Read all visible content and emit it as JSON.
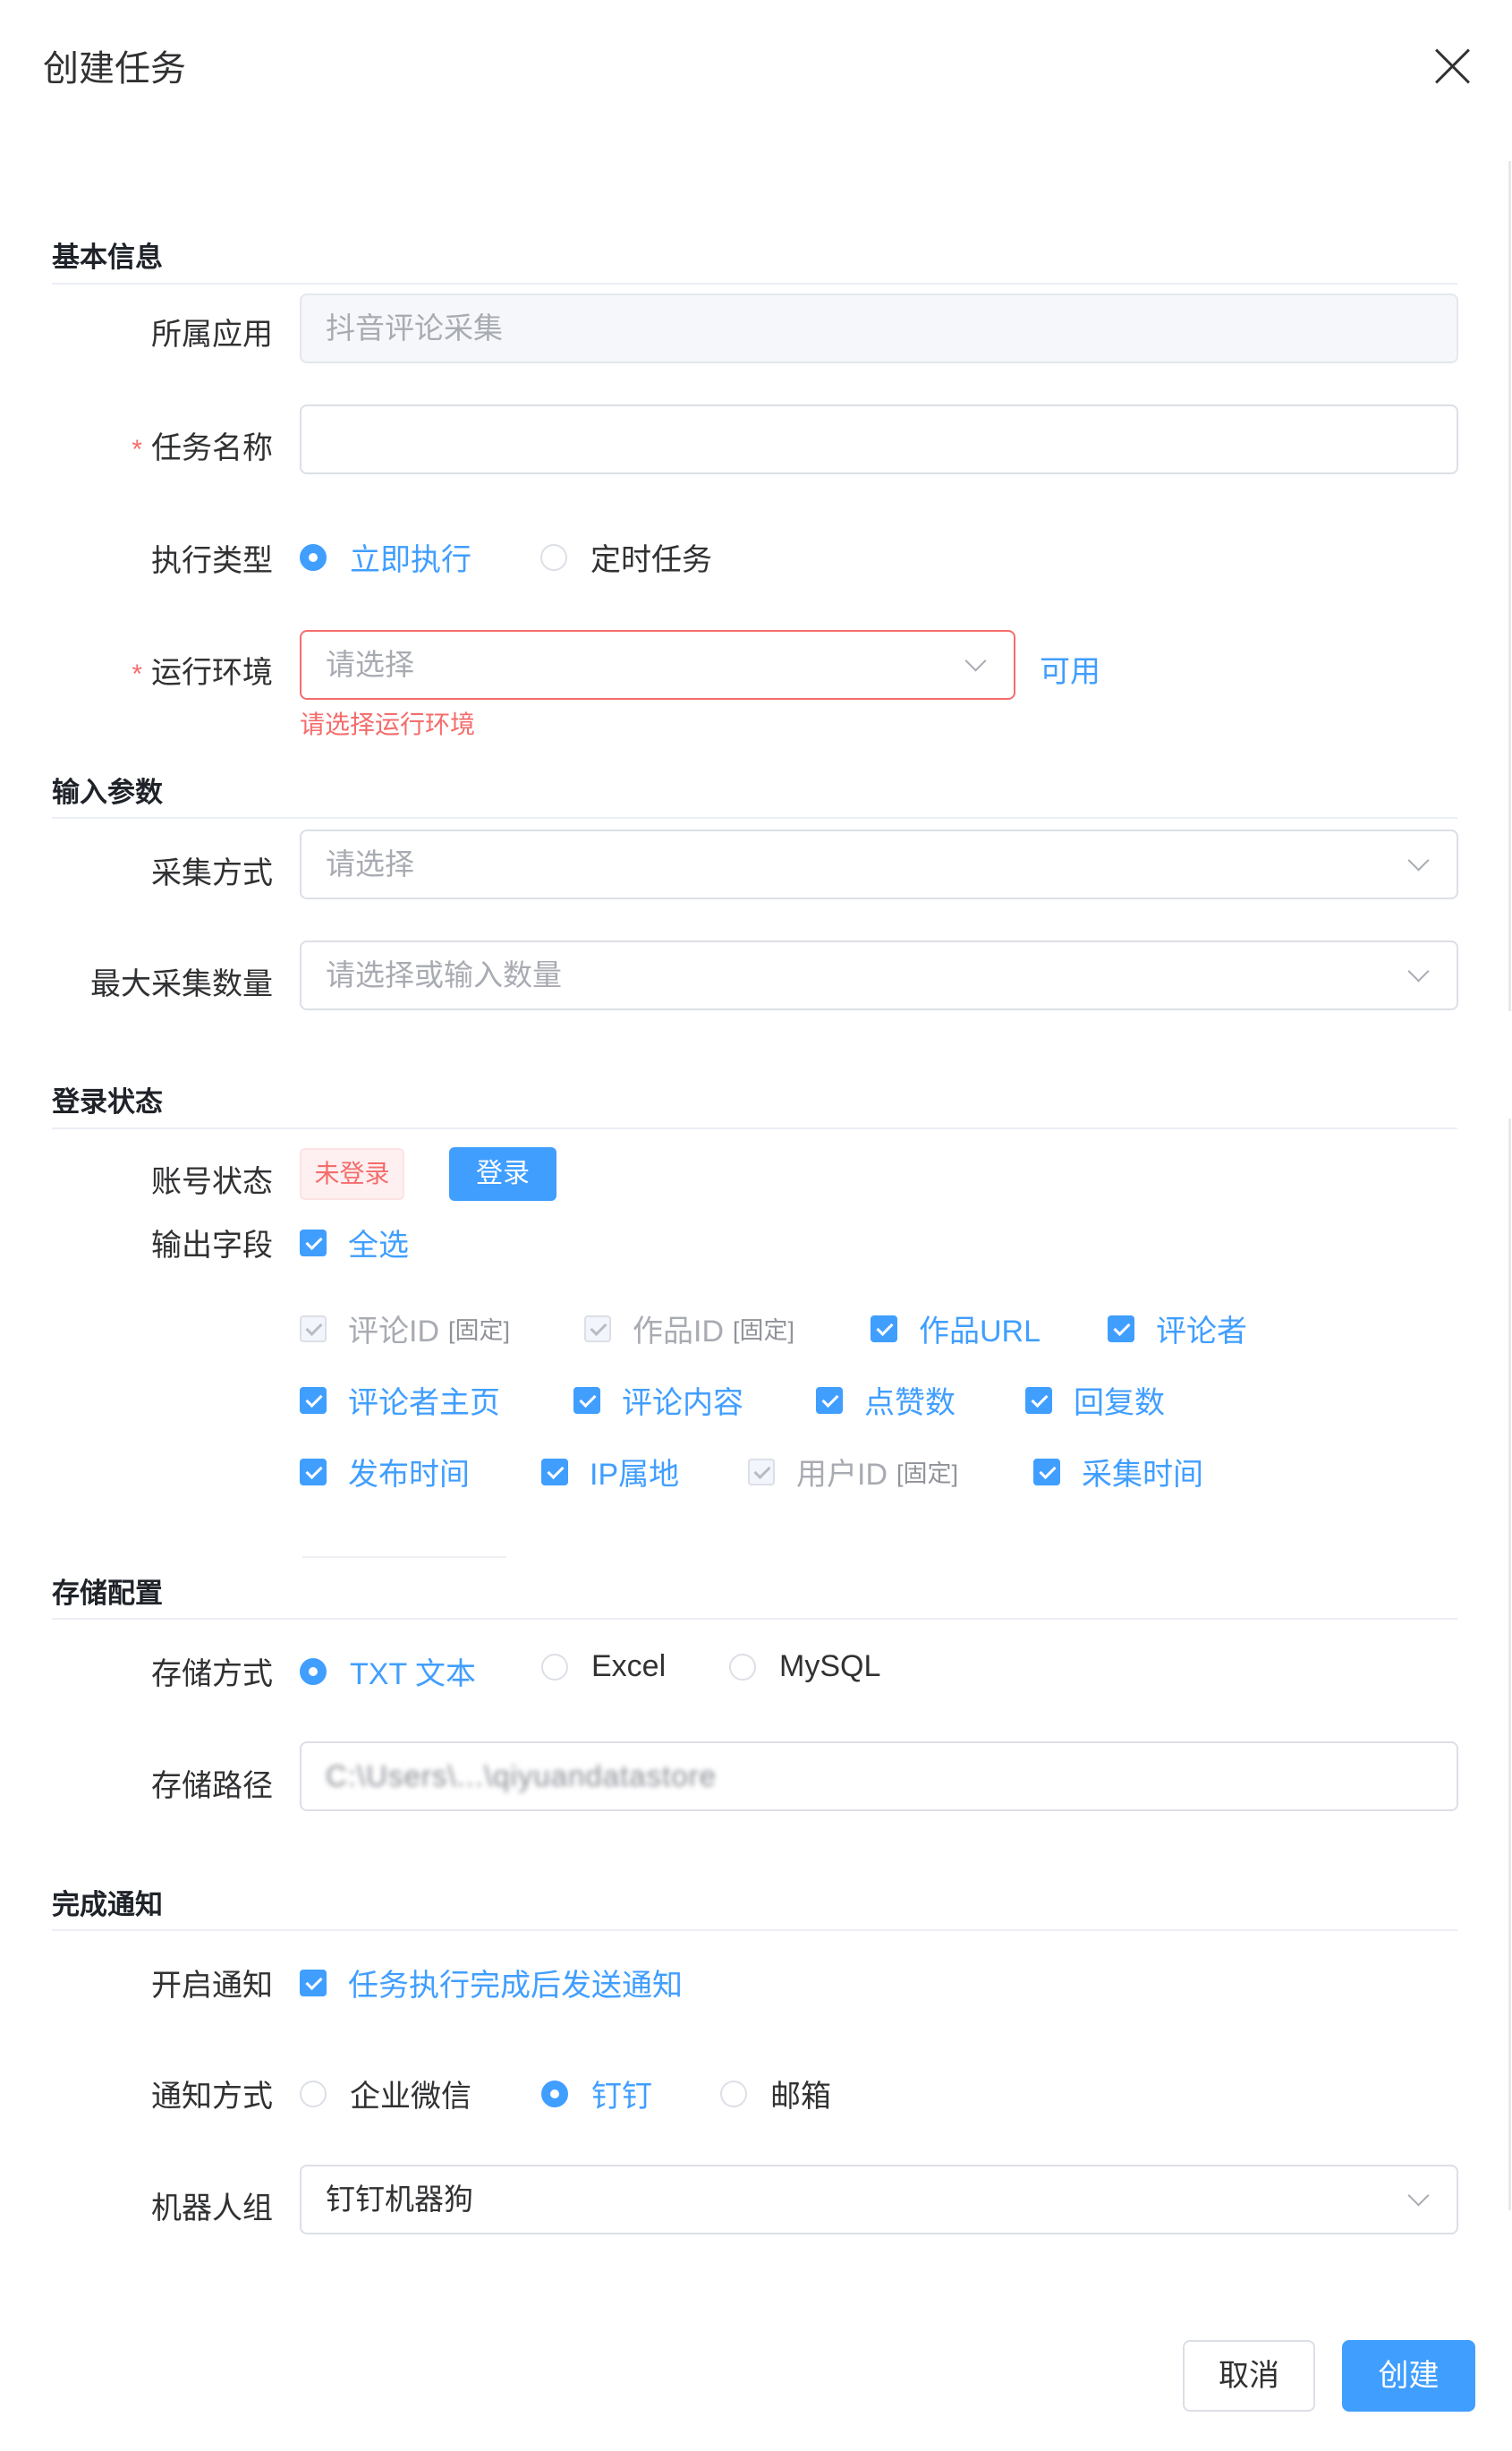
{
  "dialog": {
    "title": "创建任务"
  },
  "sections": {
    "basic": "基本信息",
    "input": "输入参数",
    "login": "登录状态",
    "storage": "存储配置",
    "notify": "完成通知"
  },
  "basic": {
    "app_label": "所属应用",
    "app_value": "抖音评论采集",
    "task_name_label": "任务名称",
    "task_name_value": "",
    "exec_type_label": "执行类型",
    "exec_options": [
      "立即执行",
      "定时任务"
    ],
    "exec_selected": "立即执行",
    "env_label": "运行环境",
    "env_placeholder": "请选择",
    "env_link": "可用",
    "env_error": "请选择运行环境"
  },
  "input": {
    "method_label": "采集方式",
    "method_placeholder": "请选择",
    "max_label": "最大采集数量",
    "max_placeholder": "请选择或输入数量"
  },
  "login": {
    "status_label": "账号状态",
    "status_value": "未登录",
    "login_button": "登录",
    "fields_label": "输出字段",
    "select_all": "全选",
    "fixed_tag": "[固定]",
    "fields": [
      {
        "label": "评论ID",
        "fixed": true
      },
      {
        "label": "作品ID",
        "fixed": true
      },
      {
        "label": "作品URL",
        "fixed": false
      },
      {
        "label": "评论者",
        "fixed": false
      },
      {
        "label": "评论者主页",
        "fixed": false
      },
      {
        "label": "评论内容",
        "fixed": false
      },
      {
        "label": "点赞数",
        "fixed": false
      },
      {
        "label": "回复数",
        "fixed": false
      },
      {
        "label": "发布时间",
        "fixed": false
      },
      {
        "label": "IP属地",
        "fixed": false
      },
      {
        "label": "用户ID",
        "fixed": true
      },
      {
        "label": "采集时间",
        "fixed": false
      }
    ]
  },
  "storage": {
    "method_label": "存储方式",
    "options": [
      "TXT 文本",
      "Excel",
      "MySQL"
    ],
    "selected": "TXT 文本",
    "path_label": "存储路径",
    "path_value": "C:\\Users\\...\\qiyuandatastore"
  },
  "notify": {
    "enable_label": "开启通知",
    "enable_text": "任务执行完成后发送通知",
    "method_label": "通知方式",
    "options": [
      "企业微信",
      "钉钉",
      "邮箱"
    ],
    "selected": "钉钉",
    "robot_label": "机器人组",
    "robot_value": "钉钉机器狗"
  },
  "footer": {
    "cancel": "取消",
    "create": "创建"
  },
  "colors": {
    "primary": "#409eff",
    "danger": "#f56c6c",
    "border": "#dcdfe6",
    "placeholder": "#a8abb2"
  }
}
